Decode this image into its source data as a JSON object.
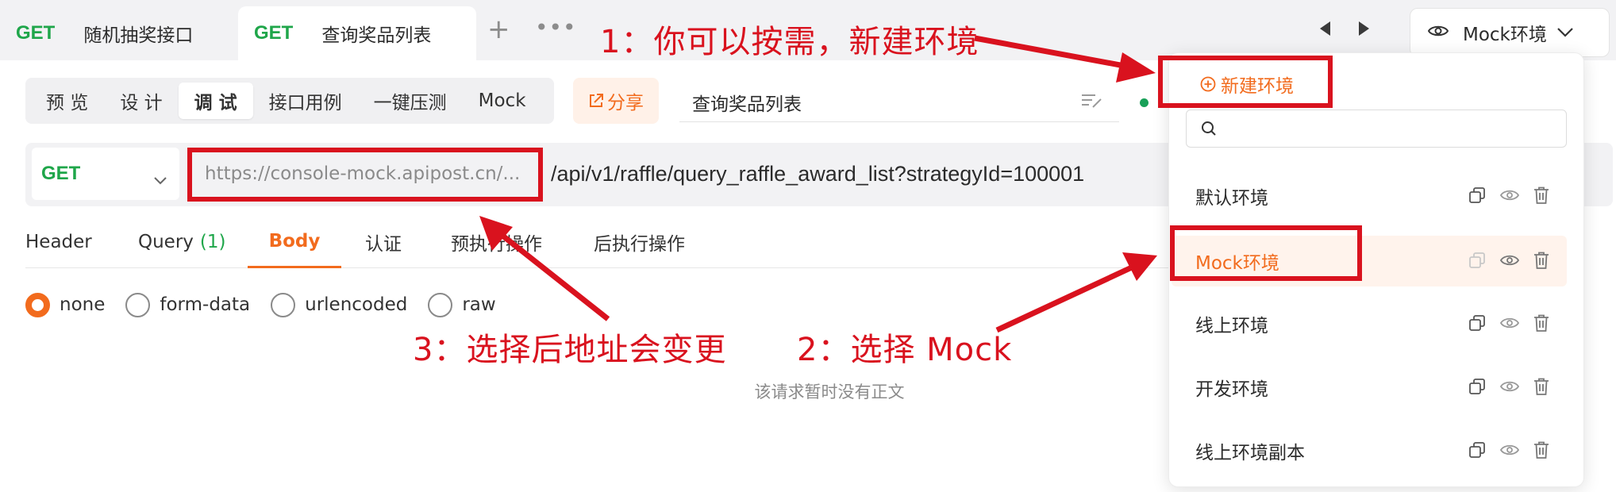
{
  "tabs": [
    {
      "method": "GET",
      "title": "随机抽奖接口"
    },
    {
      "method": "GET",
      "title": "查询奖品列表"
    }
  ],
  "environment_selector": {
    "value": "Mock环境"
  },
  "modes": [
    "预 览",
    "设 计",
    "调 试",
    "接口用例",
    "一键压测",
    "Mock"
  ],
  "active_mode": "调 试",
  "share_label": "分享",
  "api_name": "查询奖品列表",
  "request": {
    "method": "GET",
    "base_url": "https://console-mock.apipost.cn/...",
    "path": "/api/v1/raffle/query_raffle_award_list?strategyId=100001"
  },
  "request_tabs": {
    "header": "Header",
    "query": "Query",
    "query_count": "(1)",
    "body": "Body",
    "auth": "认证",
    "pre": "预执行操作",
    "post": "后执行操作"
  },
  "body_types": [
    "none",
    "form-data",
    "urlencoded",
    "raw"
  ],
  "selected_body_type": "none",
  "empty_body_text": "该请求暂时没有正文",
  "env_dropdown": {
    "new_env_label": "新建环境",
    "search_placeholder": "",
    "items": [
      "默认环境",
      "Mock环境",
      "线上环境",
      "开发环境",
      "线上环境副本"
    ],
    "selected": "Mock环境"
  },
  "annotations": {
    "note1": "1：你可以按需，新建环境",
    "note2": "2：选择 Mock",
    "note3": "3：选择后地址会变更"
  },
  "colors": {
    "accent": "#f26b1d",
    "method_get": "#1fa64a",
    "annotation": "#d9121e"
  }
}
